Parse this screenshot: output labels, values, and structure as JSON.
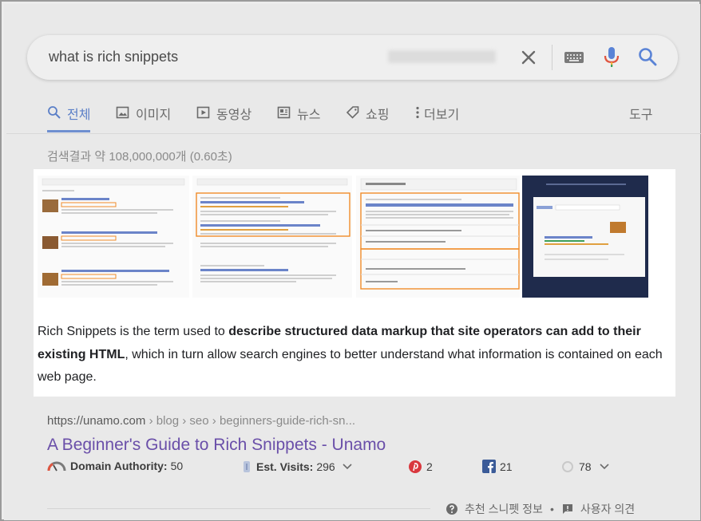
{
  "search": {
    "query": "what is rich snippets"
  },
  "tabs": [
    {
      "label": "전체",
      "icon": "search-icon",
      "active": true
    },
    {
      "label": "이미지",
      "icon": "image-icon",
      "active": false
    },
    {
      "label": "동영상",
      "icon": "video-icon",
      "active": false
    },
    {
      "label": "뉴스",
      "icon": "news-icon",
      "active": false
    },
    {
      "label": "쇼핑",
      "icon": "tag-icon",
      "active": false
    },
    {
      "label": "더보기",
      "icon": "more-icon",
      "active": false
    }
  ],
  "tools_label": "도구",
  "result_stats": "검색결과 약 108,000,000개 (0.60초)",
  "snippet": {
    "text_plain_1": "Rich Snippets is the term used to ",
    "text_bold": "describe structured data markup that site operators can add to their existing HTML",
    "text_plain_2": ", which in turn allow search engines to better understand what information is contained on each web page.",
    "thumbnails": [
      {
        "label": "rich snippet recipe thumbnail"
      },
      {
        "label": "rich snippet camera thumbnail"
      },
      {
        "label": "rich snippet travel insurance thumbnail"
      },
      {
        "label": "rich snippet search preview thumbnail"
      }
    ]
  },
  "result": {
    "url_host": "https://unamo.com",
    "url_path": " › blog › seo › beginners-guide-rich-sn...",
    "title": "A Beginner's Guide to Rich Snippets - Unamo"
  },
  "metrics": {
    "domain_authority_label": "Domain Authority:",
    "domain_authority_value": "50",
    "est_visits_label": "Est. Visits:",
    "est_visits_value": "296",
    "pinterest_count": "2",
    "facebook_count": "21",
    "other_count": "78"
  },
  "footer": {
    "featured_info": "추천 스니펫 정보",
    "separator": "•",
    "feedback": "사용자 의견"
  },
  "colors": {
    "accent_blue": "#5b7fc7",
    "title_purple": "#6a4fa9",
    "snippet_border_orange": "#f08c2a",
    "pinterest_red": "#d9383e",
    "facebook_blue": "#3b5b98"
  }
}
